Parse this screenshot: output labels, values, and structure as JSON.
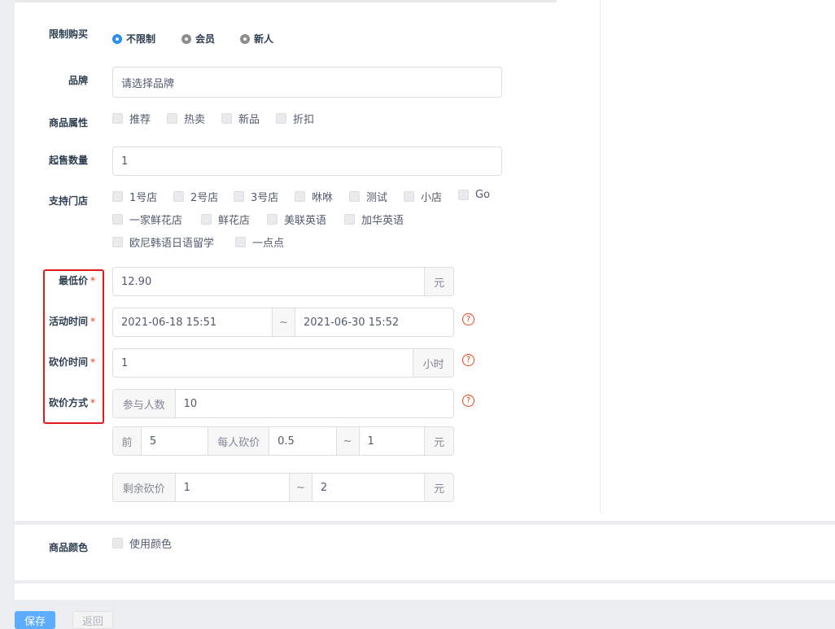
{
  "purchase_limit": {
    "label": "限制购买",
    "options": [
      "不限制",
      "会员",
      "新人"
    ],
    "selected": "不限制"
  },
  "brand": {
    "label": "品牌",
    "placeholder": "请选择品牌"
  },
  "attributes": {
    "label": "商品属性",
    "options": [
      "推荐",
      "热卖",
      "新品",
      "折扣"
    ]
  },
  "min_qty": {
    "label": "起售数量",
    "value": "1"
  },
  "stores": {
    "label": "支持门店",
    "options": [
      "1号店",
      "2号店",
      "3号店",
      "咻咻",
      "测试",
      "小店",
      "Go",
      "一家鲜花店",
      "鲜花店",
      "美联英语",
      "加华英语",
      "欧尼韩语日语留学",
      "一点点"
    ]
  },
  "min_price": {
    "label": "最低价",
    "required": "*",
    "value": "12.90",
    "unit": "元"
  },
  "activity_time": {
    "label": "活动时间",
    "required": "*",
    "start": "2021-06-18 15:51",
    "sep": "~",
    "end": "2021-06-30 15:52",
    "help": "?"
  },
  "cut_time": {
    "label": "砍价时间",
    "required": "*",
    "value": "1",
    "unit": "小时",
    "help": "?"
  },
  "cut_method": {
    "label": "砍价方式",
    "required": "*",
    "help": "?",
    "participants_label": "参与人数",
    "participants": "10",
    "front_label": "前",
    "front_value": "5",
    "each_label": "每人砍价",
    "each_min": "0.5",
    "sep": "~",
    "each_max": "1",
    "unit": "元",
    "rest_label": "剩余砍价",
    "rest_min": "1",
    "rest_max": "2"
  },
  "color": {
    "label": "商品颜色",
    "option": "使用颜色"
  },
  "actions": {
    "save": "保存",
    "back": "返回"
  }
}
